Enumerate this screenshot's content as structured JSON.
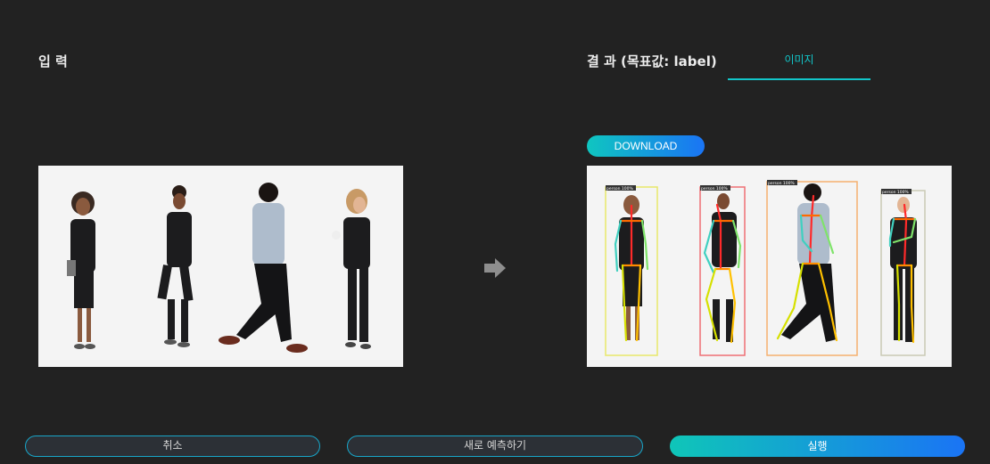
{
  "input_section": {
    "title": "입 력"
  },
  "result_section": {
    "title": "결 과 (목표값: label)",
    "tabs": [
      {
        "label": "이미지",
        "active": true
      }
    ],
    "download_label": "DOWNLOAD",
    "detections": [
      {
        "label": "person 100%",
        "box_color": "#e8e86a"
      },
      {
        "label": "person 100%",
        "box_color": "#ef6f74"
      },
      {
        "label": "person 100%",
        "box_color": "#f5b06e"
      },
      {
        "label": "person 100%",
        "box_color": "#c9c9b4"
      }
    ]
  },
  "actions": {
    "cancel_label": "취소",
    "repredict_label": "새로 예측하기",
    "run_label": "실행"
  },
  "colors": {
    "background": "#222222",
    "accent": "#12c6c9",
    "gradient_start": "#0fc6c0",
    "gradient_end": "#1a74f5",
    "panel_bg": "#f4f4f4"
  },
  "icons": {
    "arrow": "arrow-right-icon"
  }
}
